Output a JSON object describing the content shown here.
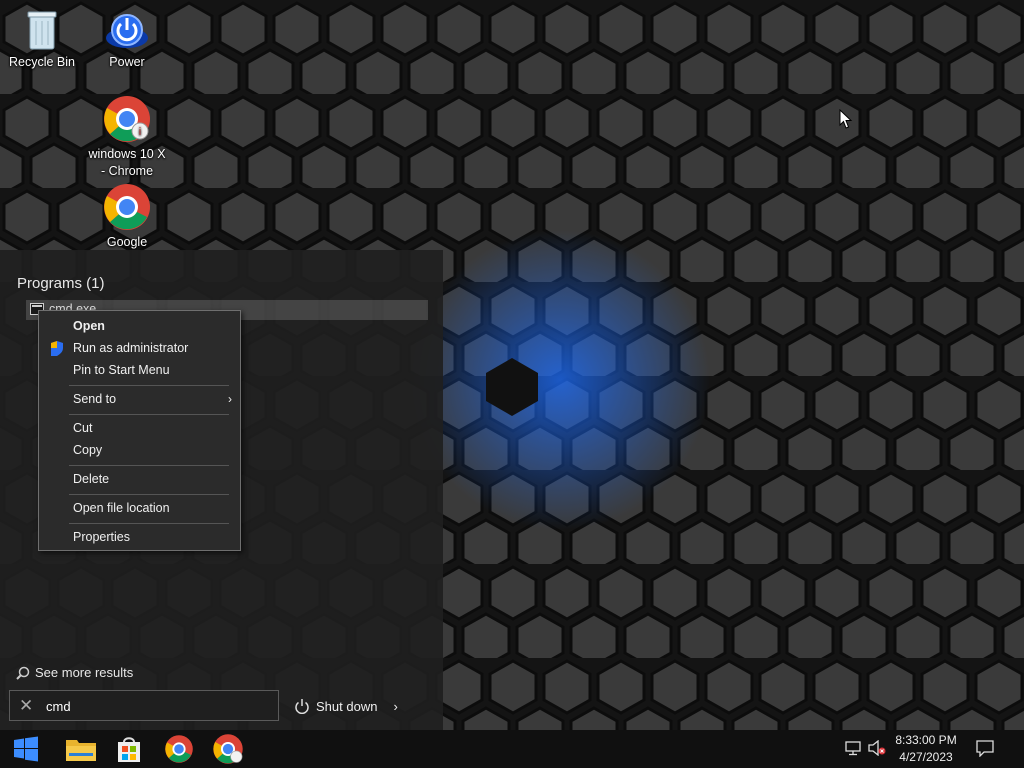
{
  "desktop": {
    "icons": [
      {
        "label": "Recycle Bin",
        "icon": "recycle-bin-icon"
      },
      {
        "label": "Power",
        "icon": "power-icon"
      },
      {
        "label": "windows 10 X - Chrome",
        "icon": "chrome-shortcut-icon"
      },
      {
        "label": "Google",
        "icon": "chrome-icon"
      }
    ]
  },
  "start_menu": {
    "programs_header": "Programs (1)",
    "program_result": "cmd.exe",
    "see_more": "See more results",
    "search_value": "cmd",
    "shutdown_label": "Shut down"
  },
  "context_menu": {
    "items": [
      {
        "label": "Open"
      },
      {
        "label": "Run as administrator"
      },
      {
        "label": "Pin to Start Menu"
      },
      {
        "label": "Send to"
      },
      {
        "label": "Cut"
      },
      {
        "label": "Copy"
      },
      {
        "label": "Delete"
      },
      {
        "label": "Open file location"
      },
      {
        "label": "Properties"
      }
    ]
  },
  "taskbar": {
    "time": "8:33:00 PM",
    "date": "4/27/2023"
  },
  "colors": {
    "accent_blue": "#1e6fff",
    "chrome_red": "#db4437",
    "chrome_yellow": "#f4b400",
    "chrome_green": "#0f9d58"
  }
}
